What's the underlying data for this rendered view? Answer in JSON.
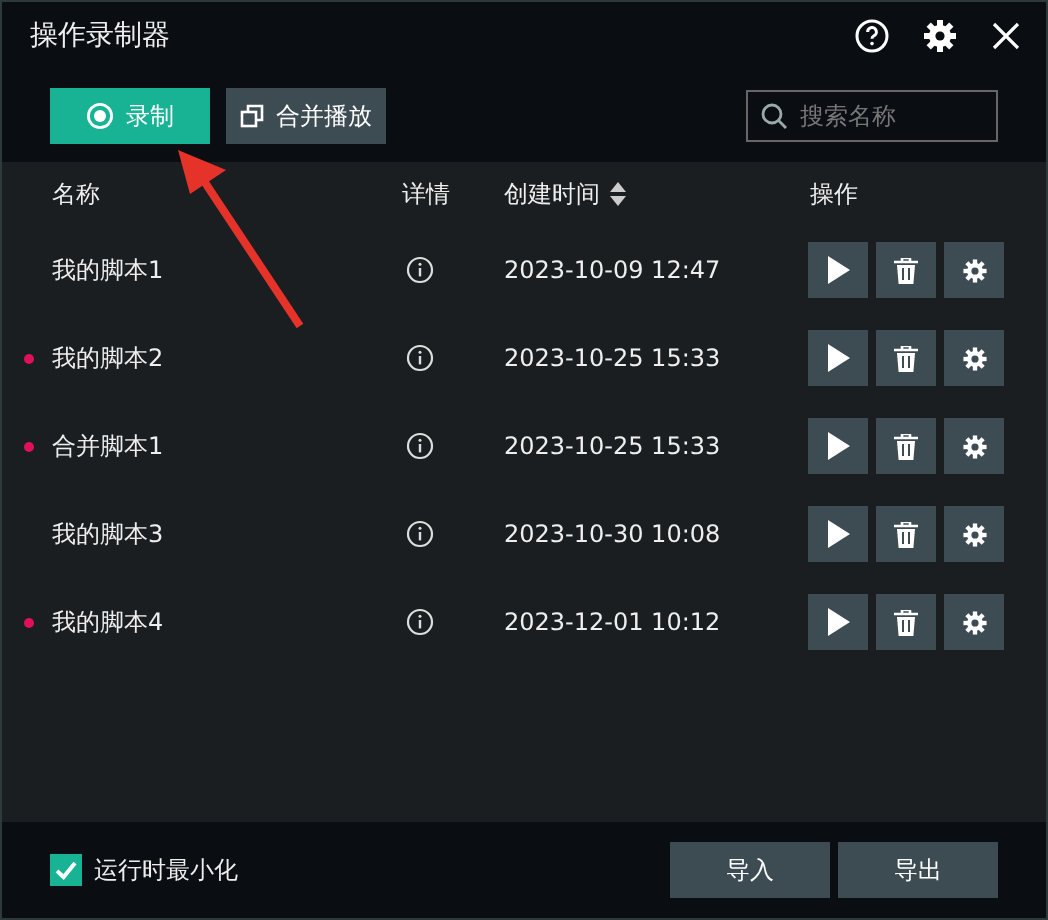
{
  "window": {
    "title": "操作录制器"
  },
  "toolbar": {
    "record_button": "录制",
    "merge_button": "合并播放",
    "search": {
      "placeholder": "搜索名称"
    }
  },
  "table": {
    "columns": [
      "名称",
      "详情",
      "创建时间",
      "操作"
    ],
    "rows": [
      {
        "name": "我的脚本1",
        "marked": false,
        "created": "2023-10-09 12:47"
      },
      {
        "name": "我的脚本2",
        "marked": true,
        "created": "2023-10-25 15:33"
      },
      {
        "name": "合并脚本1",
        "marked": true,
        "created": "2023-10-25 15:33"
      },
      {
        "name": "我的脚本3",
        "marked": false,
        "created": "2023-10-30 10:08"
      },
      {
        "name": "我的脚本4",
        "marked": true,
        "created": "2023-12-01 10:12"
      }
    ]
  },
  "footer": {
    "minimize_option": {
      "label": "运行时最小化",
      "checked": true
    },
    "buttons": [
      "导入",
      "导出"
    ]
  }
}
